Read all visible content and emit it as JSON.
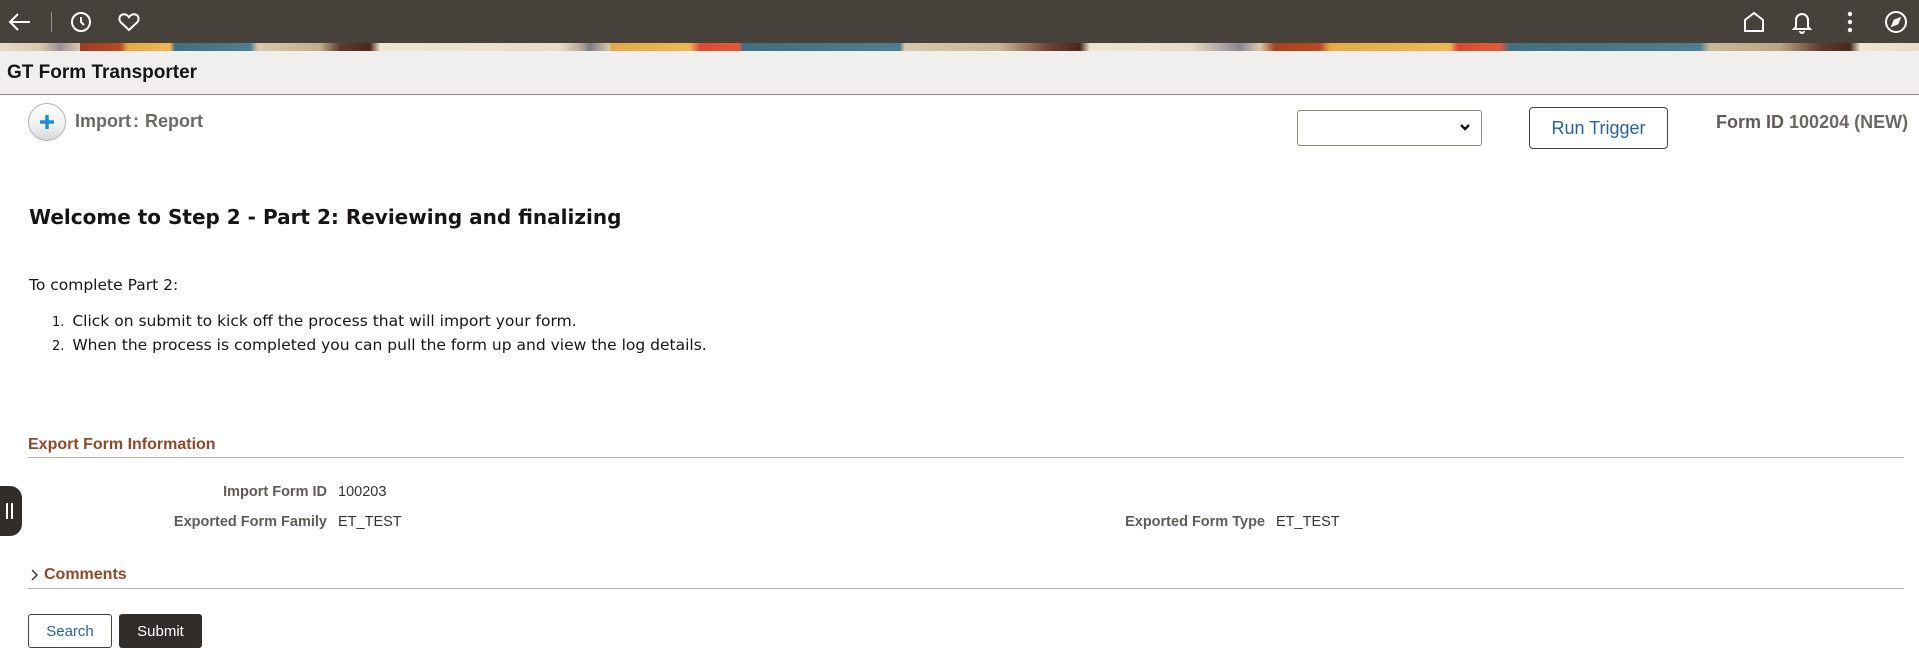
{
  "topbar": {
    "icons": {
      "back": "back-arrow-icon",
      "recent": "clock-icon",
      "favorites": "heart-icon",
      "home": "home-icon",
      "notifications": "bell-icon",
      "actions": "more-vertical-icon",
      "navigator": "compass-icon"
    }
  },
  "page": {
    "title": "GT Form Transporter"
  },
  "action_row": {
    "add_icon": "plus-icon",
    "breadcrumb": {
      "first": "Import",
      "separator": ":",
      "second": "Report"
    },
    "select": {
      "selected_value": ""
    },
    "run_trigger_label": "Run Trigger",
    "form_id_label": "Form ID",
    "form_id_value": "100204 (NEW)"
  },
  "content": {
    "heading": "Welcome to Step 2 - Part 2: Reviewing and finalizing",
    "intro": "To complete Part 2:",
    "steps": [
      {
        "num": "1.",
        "text": "Click on submit to kick off the process that will import your form."
      },
      {
        "num": "2.",
        "text": "When the process is completed you can pull the form up and view the log details."
      }
    ]
  },
  "export_section": {
    "title": "Export Form Information",
    "fields": {
      "import_form_id": {
        "label": "Import Form ID",
        "value": "100203"
      },
      "exported_form_family": {
        "label": "Exported Form Family",
        "value": "ET_TEST"
      },
      "exported_form_type": {
        "label": "Exported Form Type",
        "value": "ET_TEST"
      }
    }
  },
  "comments": {
    "label": "Comments",
    "expanded": false
  },
  "buttons": {
    "search": "Search",
    "submit": "Submit"
  },
  "colors": {
    "topbar_bg": "#47413c",
    "section_title": "#8b4a2b",
    "link_blue": "#2a6496",
    "primary_button": "#312d2a"
  }
}
